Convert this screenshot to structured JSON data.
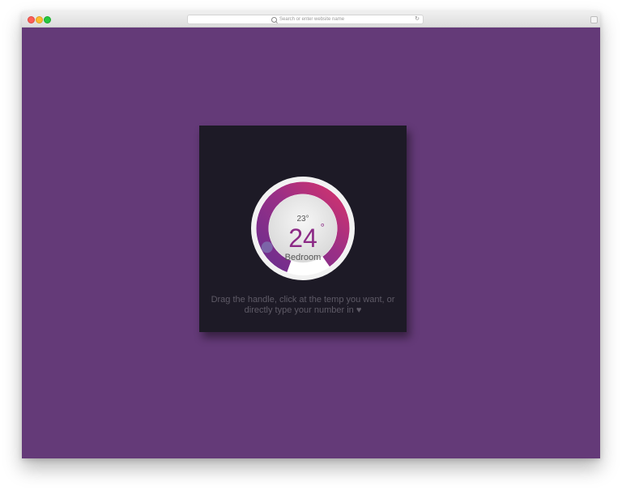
{
  "browser": {
    "url_placeholder": "Search or enter website name",
    "reload_icon": "reload-icon"
  },
  "thermostat": {
    "target_temp": "23°",
    "current_temp": "24",
    "degree": "°",
    "room": "Bedroom",
    "level": 0.42,
    "colors": {
      "arc_start": "#6b2e8e",
      "arc_end": "#d4336d",
      "handle": "#7c64a8",
      "background": "#643a78",
      "card": "#1d1a26",
      "temp_accent": "#8c2a86"
    }
  },
  "instructions": {
    "text": "Drag the handle, click at the temp you want, or directly type your number in",
    "icon": "heart-icon"
  }
}
